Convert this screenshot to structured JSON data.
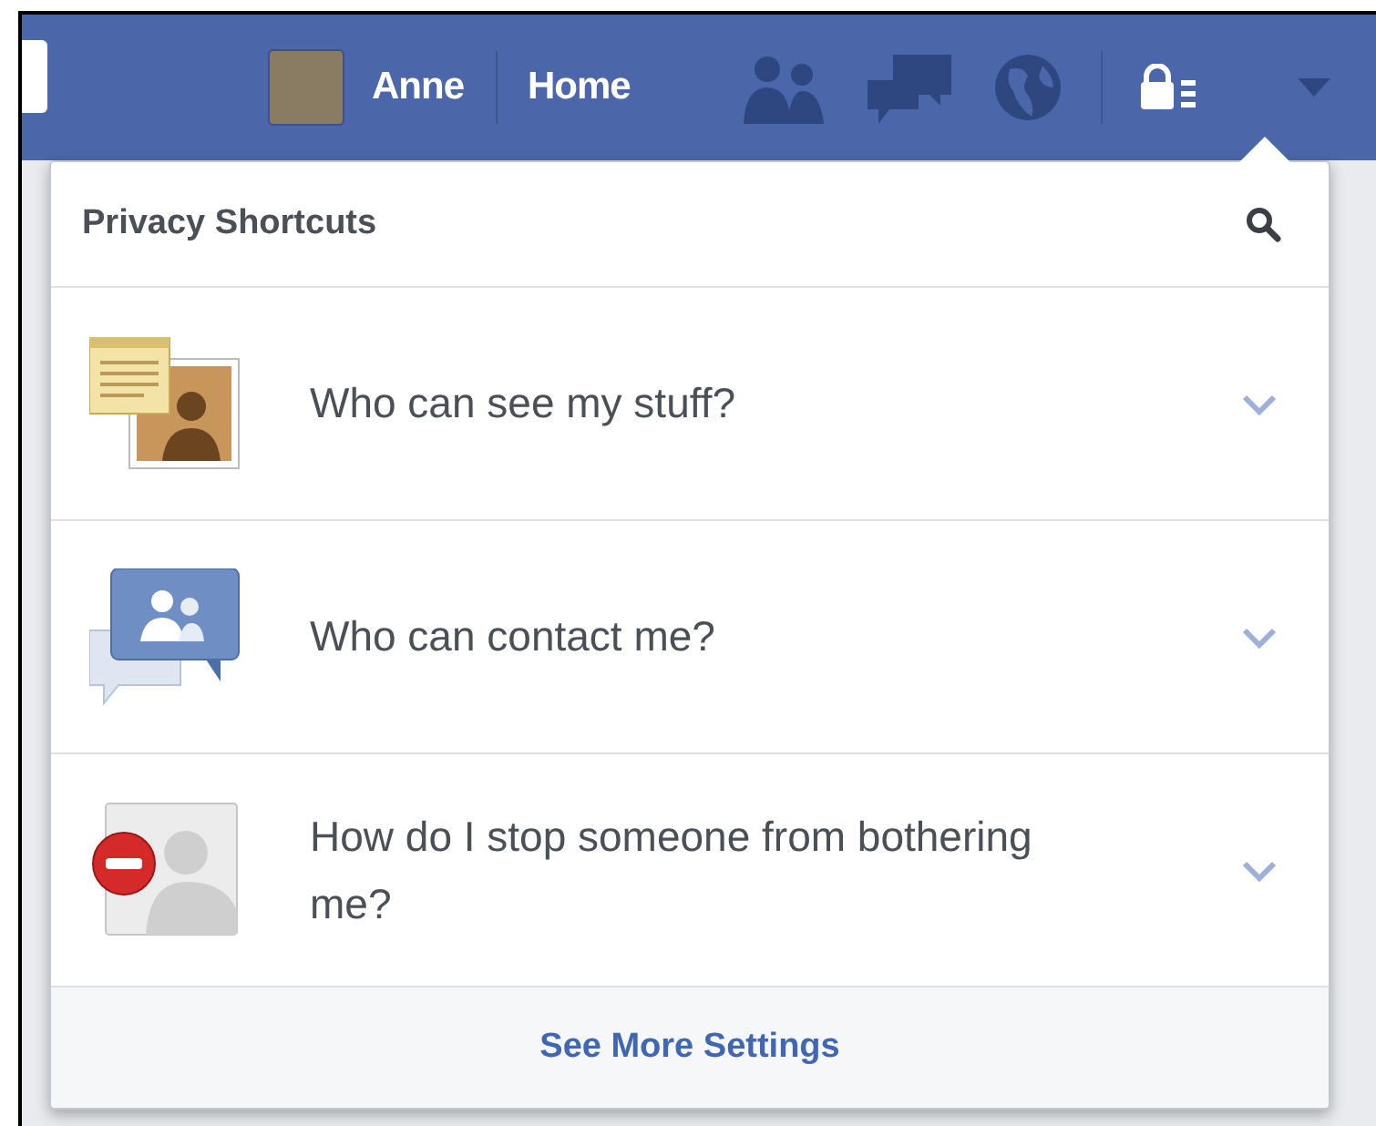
{
  "top_bar": {
    "user_name": "Anne",
    "home_link": "Home"
  },
  "privacy_menu": {
    "title": "Privacy Shortcuts",
    "items": [
      {
        "kind": "visibility",
        "label": "Who can see my stuff?"
      },
      {
        "kind": "contact",
        "label": "Who can contact me?"
      },
      {
        "kind": "block",
        "label": "How do I stop someone from bothering me?"
      }
    ],
    "footer_link": "See More Settings"
  }
}
